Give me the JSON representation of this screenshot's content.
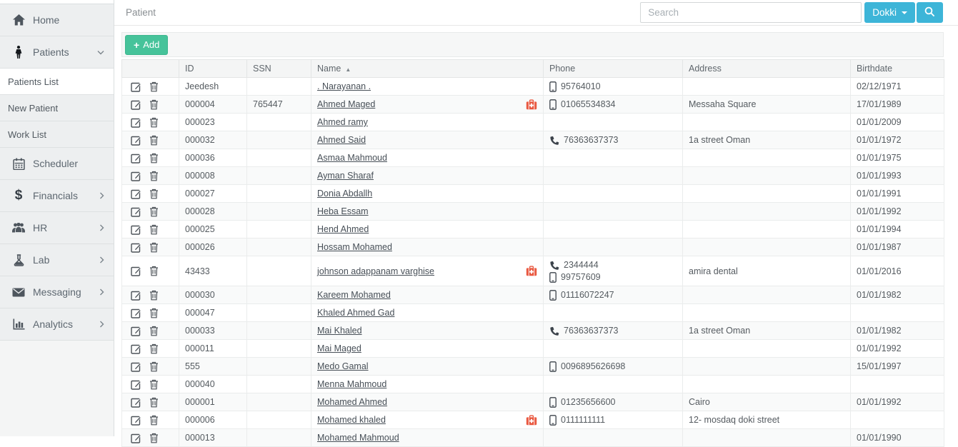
{
  "topbar": {
    "title": "Patient",
    "search_placeholder": "Search",
    "branch_button_label": "Dokki"
  },
  "sidebar": {
    "items": [
      {
        "label": "Home",
        "icon": "home"
      },
      {
        "label": "Patients",
        "icon": "patient",
        "expanded": true
      },
      {
        "label": "Patients List",
        "active": true
      },
      {
        "label": "New Patient"
      },
      {
        "label": "Work List"
      },
      {
        "label": "Scheduler",
        "icon": "calendar"
      },
      {
        "label": "Financials",
        "icon": "dollar",
        "collapsed": true
      },
      {
        "label": "HR",
        "icon": "users",
        "collapsed": true
      },
      {
        "label": "Lab",
        "icon": "flask",
        "collapsed": true
      },
      {
        "label": "Messaging",
        "icon": "envelope",
        "collapsed": true
      },
      {
        "label": "Analytics",
        "icon": "bar-chart",
        "collapsed": true
      }
    ]
  },
  "toolbar": {
    "add_label": "Add"
  },
  "table": {
    "columns": [
      "ID",
      "SSN",
      "Name",
      "Phone",
      "Address",
      "Birthdate"
    ],
    "sort_column": "Name",
    "sort_indicator": "▲",
    "rows": [
      {
        "id": "Jeedesh",
        "ssn": "",
        "name": ". Narayanan .",
        "medkit": false,
        "phones": [
          {
            "type": "mobile",
            "number": "95764010"
          }
        ],
        "address": "",
        "birthdate": "02/12/1971"
      },
      {
        "id": "000004",
        "ssn": "765447",
        "name": "Ahmed Maged",
        "medkit": true,
        "phones": [
          {
            "type": "mobile",
            "number": "01065534834"
          }
        ],
        "address": "Messaha Square",
        "birthdate": "17/01/1989"
      },
      {
        "id": "000023",
        "ssn": "",
        "name": "Ahmed ramy",
        "medkit": false,
        "phones": [],
        "address": "",
        "birthdate": "01/01/2009"
      },
      {
        "id": "000032",
        "ssn": "",
        "name": "Ahmed Said",
        "medkit": false,
        "phones": [
          {
            "type": "landline",
            "number": "76363637373"
          }
        ],
        "address": "1a street Oman",
        "birthdate": "01/01/1972"
      },
      {
        "id": "000036",
        "ssn": "",
        "name": "Asmaa Mahmoud",
        "medkit": false,
        "phones": [],
        "address": "",
        "birthdate": "01/01/1975"
      },
      {
        "id": "000008",
        "ssn": "",
        "name": "Ayman Sharaf",
        "medkit": false,
        "phones": [],
        "address": "",
        "birthdate": "01/01/1993"
      },
      {
        "id": "000027",
        "ssn": "",
        "name": "Donia Abdallh",
        "medkit": false,
        "phones": [],
        "address": "",
        "birthdate": "01/01/1991"
      },
      {
        "id": "000028",
        "ssn": "",
        "name": "Heba Essam",
        "medkit": false,
        "phones": [],
        "address": "",
        "birthdate": "01/01/1992"
      },
      {
        "id": "000025",
        "ssn": "",
        "name": "Hend Ahmed",
        "medkit": false,
        "phones": [],
        "address": "",
        "birthdate": "01/01/1994"
      },
      {
        "id": "000026",
        "ssn": "",
        "name": "Hossam Mohamed",
        "medkit": false,
        "phones": [],
        "address": "",
        "birthdate": "01/01/1987"
      },
      {
        "id": "43433",
        "ssn": "",
        "name": "johnson adappanam varghise",
        "medkit": true,
        "phones": [
          {
            "type": "landline",
            "number": "2344444"
          },
          {
            "type": "mobile",
            "number": "99757609"
          }
        ],
        "address": "amira dental",
        "birthdate": "01/01/2016",
        "tall": true
      },
      {
        "id": "000030",
        "ssn": "",
        "name": "Kareem Mohamed",
        "medkit": false,
        "phones": [
          {
            "type": "mobile",
            "number": "01116072247"
          }
        ],
        "address": "",
        "birthdate": "01/01/1982"
      },
      {
        "id": "000047",
        "ssn": "",
        "name": "Khaled Ahmed Gad",
        "medkit": false,
        "phones": [],
        "address": "",
        "birthdate": ""
      },
      {
        "id": "000033",
        "ssn": "",
        "name": "Mai Khaled",
        "medkit": false,
        "phones": [
          {
            "type": "landline",
            "number": "76363637373"
          }
        ],
        "address": "1a street Oman",
        "birthdate": "01/01/1982"
      },
      {
        "id": "000011",
        "ssn": "",
        "name": "Mai Maged",
        "medkit": false,
        "phones": [],
        "address": "",
        "birthdate": "01/01/1992"
      },
      {
        "id": "555",
        "ssn": "",
        "name": "Medo Gamal",
        "medkit": false,
        "phones": [
          {
            "type": "mobile",
            "number": "0096895626698"
          }
        ],
        "address": "",
        "birthdate": "15/01/1997"
      },
      {
        "id": "000040",
        "ssn": "",
        "name": "Menna Mahmoud",
        "medkit": false,
        "phones": [],
        "address": "",
        "birthdate": ""
      },
      {
        "id": "000001",
        "ssn": "",
        "name": "Mohamed Ahmed",
        "medkit": false,
        "phones": [
          {
            "type": "mobile",
            "number": "01235656600"
          }
        ],
        "address": "Cairo",
        "birthdate": "01/01/1992"
      },
      {
        "id": "000006",
        "ssn": "",
        "name": "Mohamed khaled",
        "medkit": true,
        "phones": [
          {
            "type": "mobile",
            "number": "0111111111"
          }
        ],
        "address": "12- mosdaq doki street",
        "birthdate": ""
      },
      {
        "id": "000013",
        "ssn": "",
        "name": "Mohamed Mahmoud",
        "medkit": false,
        "phones": [],
        "address": "",
        "birthdate": "01/01/1990"
      }
    ]
  },
  "colors": {
    "accent_blue": "#3db5d8",
    "accent_green": "#46c39a",
    "medkit_red": "#e9573f",
    "sidebar_item_bg": "#edeff0",
    "stripe_bg": "#f9fafa"
  }
}
